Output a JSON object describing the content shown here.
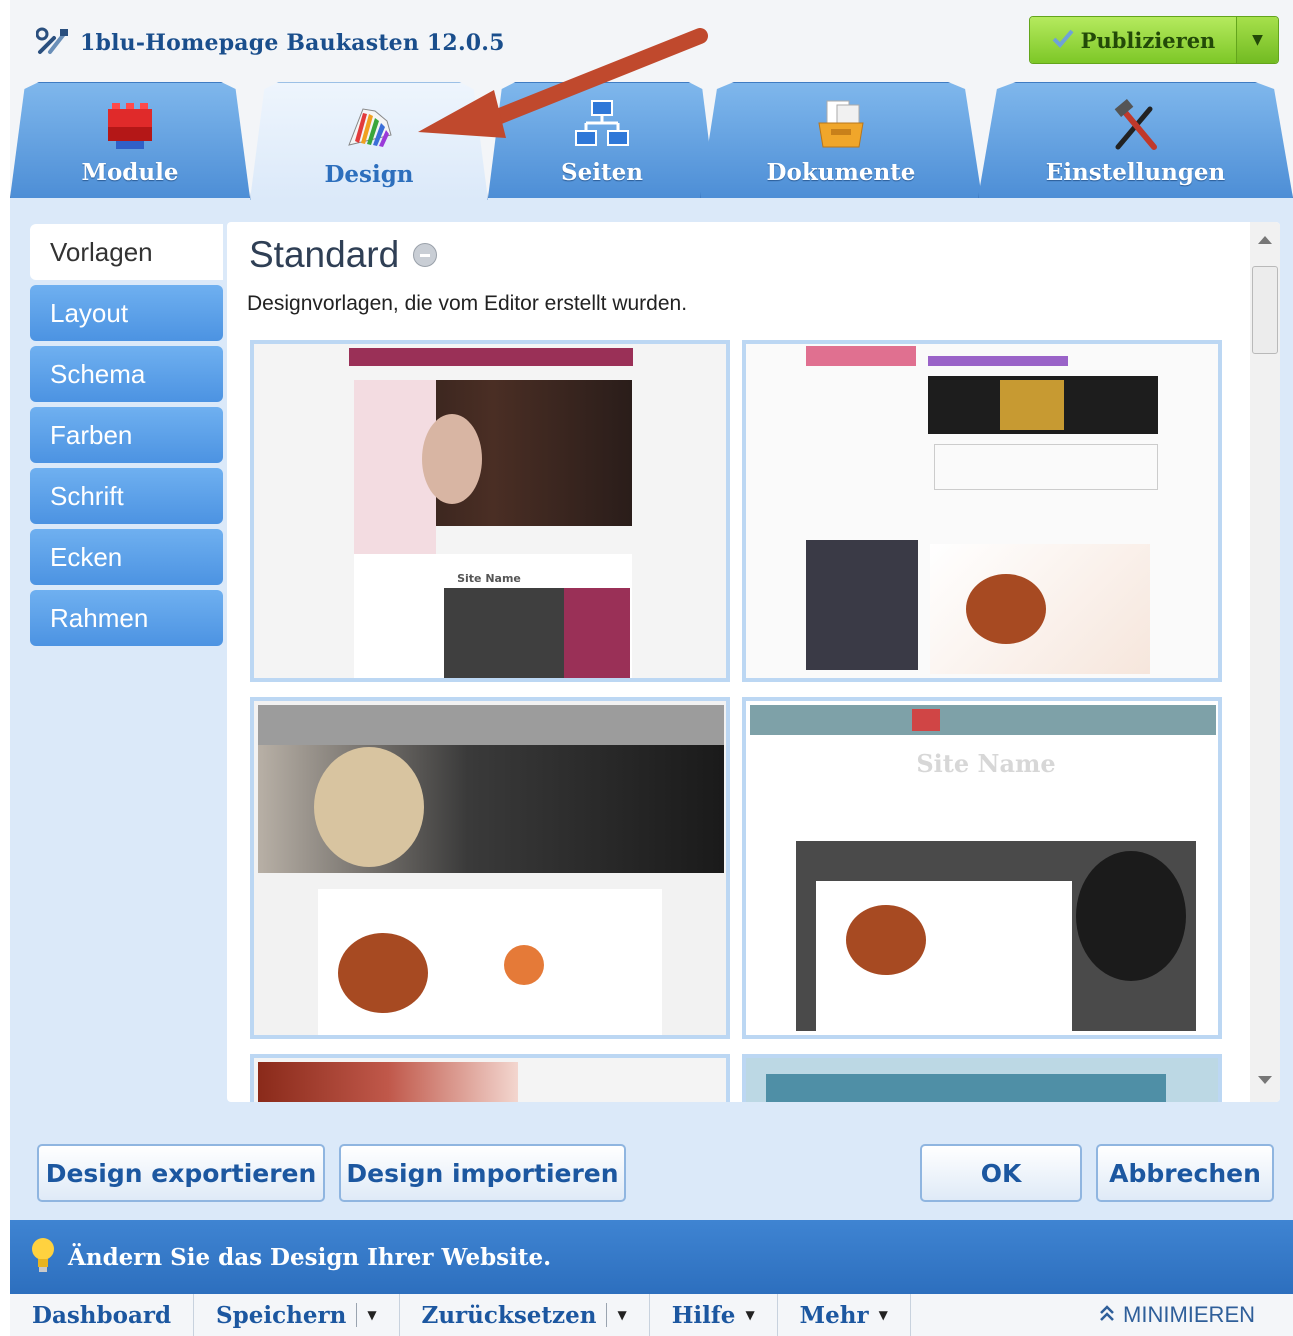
{
  "app": {
    "title": "1blu-Homepage Baukasten 12.0.5",
    "publish_label": "Publizieren"
  },
  "tabs": [
    {
      "label": "Module",
      "icon": "lego-blocks-icon"
    },
    {
      "label": "Design",
      "icon": "color-palette-icon",
      "active": true
    },
    {
      "label": "Seiten",
      "icon": "sitemap-icon"
    },
    {
      "label": "Dokumente",
      "icon": "document-box-icon"
    },
    {
      "label": "Einstellungen",
      "icon": "tools-icon"
    }
  ],
  "sidebar": {
    "items": [
      {
        "label": "Vorlagen",
        "active": true
      },
      {
        "label": "Layout"
      },
      {
        "label": "Schema"
      },
      {
        "label": "Farben"
      },
      {
        "label": "Schrift"
      },
      {
        "label": "Ecken"
      },
      {
        "label": "Rahmen"
      }
    ]
  },
  "panel": {
    "heading": "Standard",
    "description": "Designvorlagen, die vom Editor erstellt wurden.",
    "thumbs": [
      {
        "title": "Site Name"
      },
      {
        "title": ""
      },
      {
        "title": ""
      },
      {
        "title": "Site Name"
      }
    ]
  },
  "buttons": {
    "export": "Design exportieren",
    "import": "Design importieren",
    "ok": "OK",
    "cancel": "Abbrechen"
  },
  "hint": "Ändern Sie das Design Ihrer Website.",
  "footer": {
    "dashboard": "Dashboard",
    "save": "Speichern",
    "reset": "Zurücksetzen",
    "help": "Hilfe",
    "more": "Mehr",
    "minimize": "MINIMIEREN"
  },
  "colors": {
    "tab_blue": "#4d8ed6",
    "publish_green": "#7dc727",
    "hint_blue": "#2d6fbe",
    "annotation_arrow": "#c0492d"
  }
}
